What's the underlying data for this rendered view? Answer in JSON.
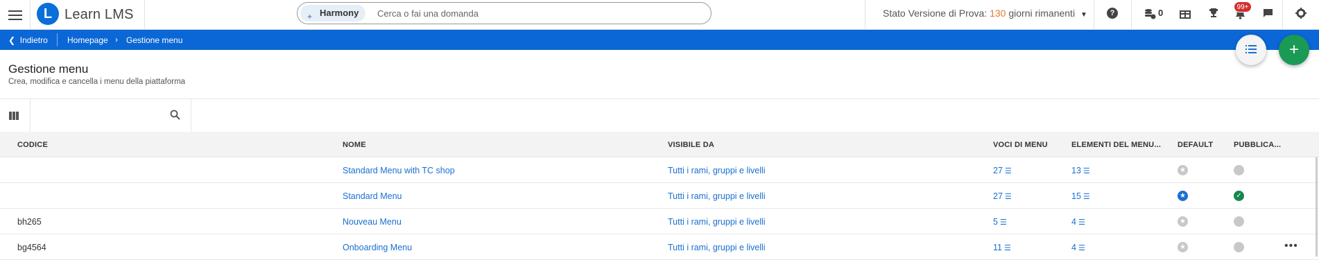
{
  "topbar": {
    "app_name": "Learn LMS",
    "logo_letter": "L",
    "search": {
      "chip": "Harmony",
      "placeholder": "Cerca o fai una domanda"
    },
    "trial": {
      "prefix": "Stato Versione di Prova:",
      "days": "130",
      "suffix": "giorni rimanenti"
    },
    "coins": "0",
    "notifications_badge": "99+",
    "icons": [
      "menu-icon",
      "help-icon",
      "coins-icon",
      "gift-icon",
      "trophy-icon",
      "bell-icon",
      "chat-icon",
      "gear-icon"
    ]
  },
  "breadcrumb": {
    "back": "Indietro",
    "home": "Homepage",
    "current": "Gestione menu"
  },
  "page": {
    "title": "Gestione menu",
    "subtitle": "Crea, modifica e cancella i menu della piattaforma"
  },
  "toolbar": {
    "search_value": "",
    "search_placeholder": ""
  },
  "table": {
    "headers": {
      "code": "CODICE",
      "name": "NOME",
      "visible": "VISIBILE DA",
      "voices": "VOCI DI MENU",
      "elements": "ELEMENTI DEL MENU...",
      "default": "DEFAULT",
      "published": "PUBBLICA..."
    },
    "rows": [
      {
        "code": "",
        "name": "Standard Menu with TC shop",
        "visible": "Tutti i rami, gruppi e livelli",
        "voices": "27",
        "elements": "13",
        "default": false,
        "published": false
      },
      {
        "code": "",
        "name": "Standard Menu",
        "visible": "Tutti i rami, gruppi e livelli",
        "voices": "27",
        "elements": "15",
        "default": true,
        "published": true
      },
      {
        "code": "bh265",
        "name": "Nouveau Menu",
        "visible": "Tutti i rami, gruppi e livelli",
        "voices": "5",
        "elements": "4",
        "default": false,
        "published": false
      },
      {
        "code": "bg4564",
        "name": "Onboarding Menu",
        "visible": "Tutti i rami, gruppi e livelli",
        "voices": "11",
        "elements": "4",
        "default": false,
        "published": false
      }
    ]
  },
  "colors": {
    "primary": "#0b67d6",
    "link": "#1a6fd0",
    "accent_orange": "#e07b2e",
    "fab_green": "#1a9a55",
    "published_green": "#16874b",
    "badge_red": "#d32f2f"
  }
}
